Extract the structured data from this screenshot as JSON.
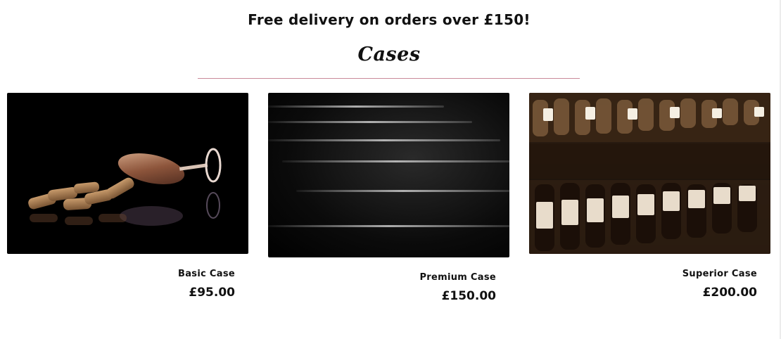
{
  "banner": {
    "text": "Free delivery on orders over £150!"
  },
  "section": {
    "title": "Cases"
  },
  "products": [
    {
      "name": "Basic Case",
      "price": "£95.00",
      "image": "corks-and-wine-glass-photo"
    },
    {
      "name": "Premium Case",
      "price": "£150.00",
      "image": "black-and-white-bottles-photo"
    },
    {
      "name": "Superior Case",
      "price": "£200.00",
      "image": "wine-cellar-racks-photo"
    }
  ],
  "colors": {
    "divider": "#c98a99",
    "text": "#111111",
    "background": "#ffffff"
  }
}
